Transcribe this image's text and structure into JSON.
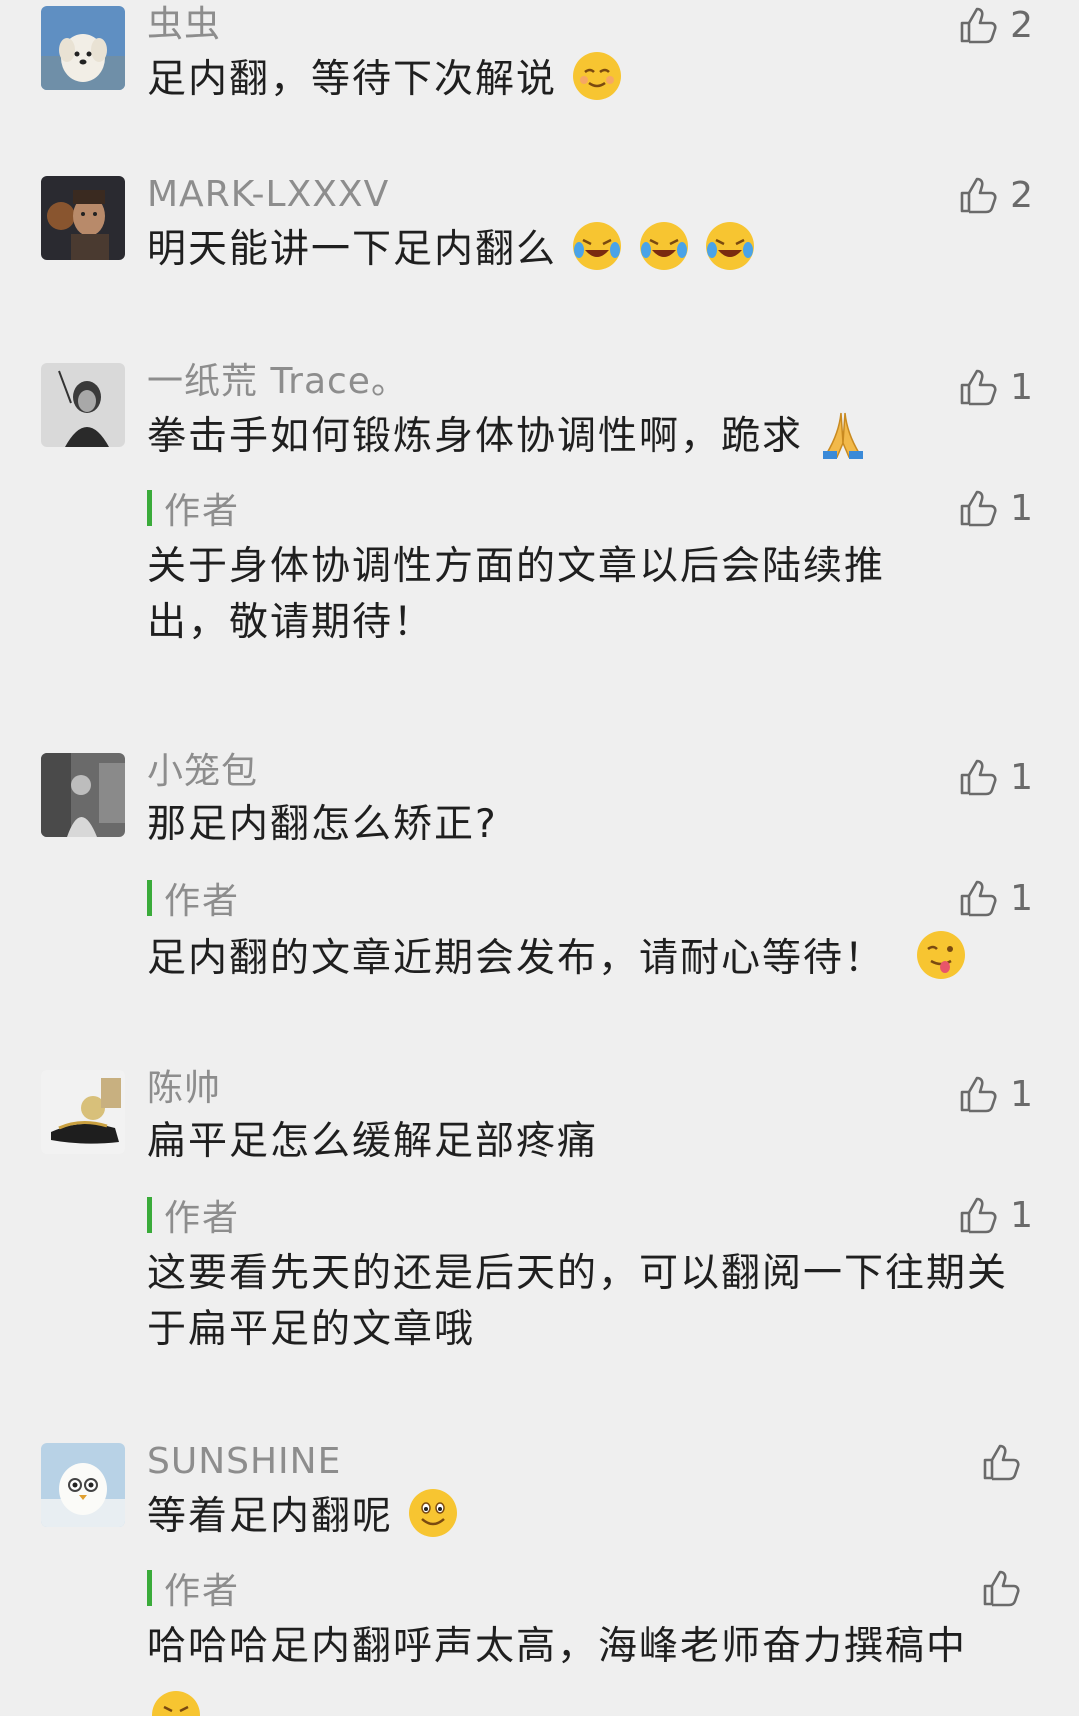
{
  "comments": [
    {
      "name": "虫虫",
      "text": "足内翻，等待下次解说",
      "likes": "2",
      "emoji": "smile-emoji"
    },
    {
      "name": "MARK-LXXXV",
      "text": "明天能讲一下足内翻么",
      "likes": "2",
      "emoji": "crying-laughing-emoji"
    },
    {
      "name": "一纸荒 Trace。",
      "text": "拳击手如何锻炼身体协调性啊，跪求",
      "likes": "1",
      "emoji": "pray-emoji",
      "reply": {
        "label": "作者",
        "text": "关于身体协调性方面的文章以后会陆续推出，敬请期待！",
        "likes": "1"
      }
    },
    {
      "name": "小笼包",
      "text": "那足内翻怎么矫正?",
      "likes": "1",
      "reply": {
        "label": "作者",
        "text": "足内翻的文章近期会发布，请耐心等待！",
        "likes": "1",
        "emoji": "wink-tongue-emoji"
      }
    },
    {
      "name": "陈帅",
      "text": "扁平足怎么缓解足部疼痛",
      "likes": "1",
      "reply": {
        "label": "作者",
        "text": "这要看先天的还是后天的，可以翻阅一下往期关于扁平足的文章哦",
        "likes": "1"
      }
    },
    {
      "name": "SUNSHINE",
      "text": "等着足内翻呢",
      "likes": "",
      "emoji": "grin-emoji",
      "reply": {
        "label": "作者",
        "text": "哈哈哈足内翻呼声太高，海峰老师奋力撰稿中",
        "likes": ""
      }
    }
  ],
  "colors": {
    "background": "#efefef",
    "author_bar": "#3aab3a",
    "name_text": "#8d8d8d"
  }
}
